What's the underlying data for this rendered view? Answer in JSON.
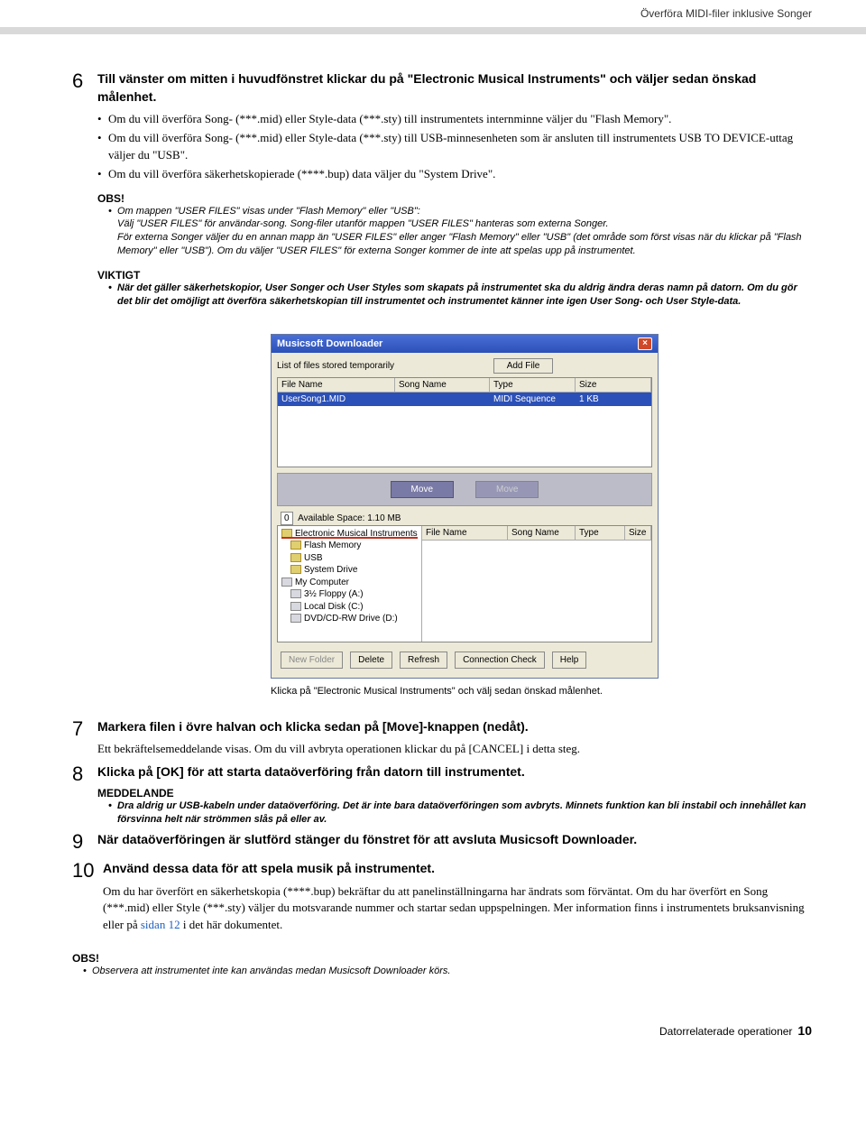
{
  "breadcrumb": "Överföra MIDI-filer inklusive Songer",
  "steps": {
    "s6": {
      "num": "6",
      "title": "Till vänster om mitten i huvudfönstret klickar du på \"Electronic Musical Instruments\" och väljer sedan önskad målenhet.",
      "b1": "Om du vill överföra Song- (***.mid) eller Style-data (***.sty) till instrumentets internminne väljer du \"Flash Memory\".",
      "b2": "Om du vill överföra Song- (***.mid) eller Style-data (***.sty) till USB-minnesenheten som är ansluten till instrumentets USB TO DEVICE-uttag väljer du \"USB\".",
      "b3": "Om du vill överföra säkerhetskopierade (****.bup) data väljer du \"System Drive\"."
    },
    "obs1": {
      "label": "OBS!",
      "text": "Om mappen \"USER FILES\" visas under \"Flash Memory\" eller \"USB\":\nVälj \"USER FILES\" för användar-song. Song-filer utanför mappen \"USER FILES\" hanteras som externa Songer.\nFör externa Songer väljer du en annan mapp än \"USER FILES\" eller anger \"Flash Memory\" eller \"USB\" (det område som först visas när du klickar på \"Flash Memory\" eller \"USB\"). Om du väljer \"USER FILES\" för externa Songer kommer de inte att spelas upp på instrumentet."
    },
    "viktigt": {
      "label": "VIKTIGT",
      "text": "När det gäller säkerhetskopior, User Songer och User Styles som skapats på instrumentet ska du aldrig ändra deras namn på datorn. Om du gör det blir det omöjligt att överföra säkerhetskopian till instrumentet och instrumentet känner inte igen User Song- och User Style-data."
    },
    "s7": {
      "num": "7",
      "title": "Markera filen i övre halvan och klicka sedan på [Move]-knappen (nedåt).",
      "text": "Ett bekräftelsemeddelande visas. Om du vill avbryta operationen klickar du på [CANCEL] i detta steg."
    },
    "s8": {
      "num": "8",
      "title": "Klicka på [OK] för att starta dataöverföring från datorn till instrumentet.",
      "mlabel": "MEDDELANDE",
      "mtext": "Dra aldrig ur USB-kabeln under dataöverföring. Det är inte bara dataöverföringen som avbryts. Minnets funktion kan bli instabil och innehållet kan försvinna helt när strömmen slås på eller av."
    },
    "s9": {
      "num": "9",
      "title": "När dataöverföringen är slutförd stänger du fönstret för att avsluta Musicsoft Downloader."
    },
    "s10": {
      "num": "10",
      "title": "Använd dessa data för att spela musik på instrumentet.",
      "text1": "Om du har överfört en säkerhetskopia (****.bup) bekräftar du att panelinställningarna har ändrats som förväntat. Om du har överfört en Song (***.mid) eller Style (***.sty) väljer du motsvarande nummer och startar sedan uppspelningen. Mer information finns i instrumentets bruksanvisning eller på ",
      "link": "sidan 12",
      "text2": " i det här dokumentet."
    },
    "obs2": {
      "label": "OBS!",
      "text": "Observera att instrumentet inte kan användas medan Musicsoft Downloader körs."
    }
  },
  "caption": "Klicka på \"Electronic Musical Instruments\" och välj sedan önskad målenhet.",
  "win": {
    "title": "Musicsoft Downloader",
    "listlbl": "List of files stored temporarily",
    "addfile": "Add File",
    "cols": {
      "c1": "File Name",
      "c2": "Song Name",
      "c3": "Type",
      "c4": "Size"
    },
    "row": {
      "fname": "UserSong1.MID",
      "sname": "",
      "type": "MIDI Sequence",
      "size": "1 KB"
    },
    "move": "Move",
    "space": "Available Space: 1.10 MB",
    "tree": {
      "root": "Electronic Musical Instruments",
      "flash": "Flash Memory",
      "usb": "USB",
      "sys": "System Drive",
      "pc": "My Computer",
      "floppy": "3½ Floppy (A:)",
      "local": "Local Disk (C:)",
      "dvd": "DVD/CD-RW Drive (D:)"
    },
    "cols2": {
      "c1": "File Name",
      "c2": "Song Name",
      "c3": "Type",
      "c4": "Size"
    },
    "btns": {
      "nf": "New Folder",
      "del": "Delete",
      "ref": "Refresh",
      "cc": "Connection Check",
      "help": "Help"
    }
  },
  "footer": {
    "text": "Datorrelaterade operationer",
    "page": "10"
  }
}
